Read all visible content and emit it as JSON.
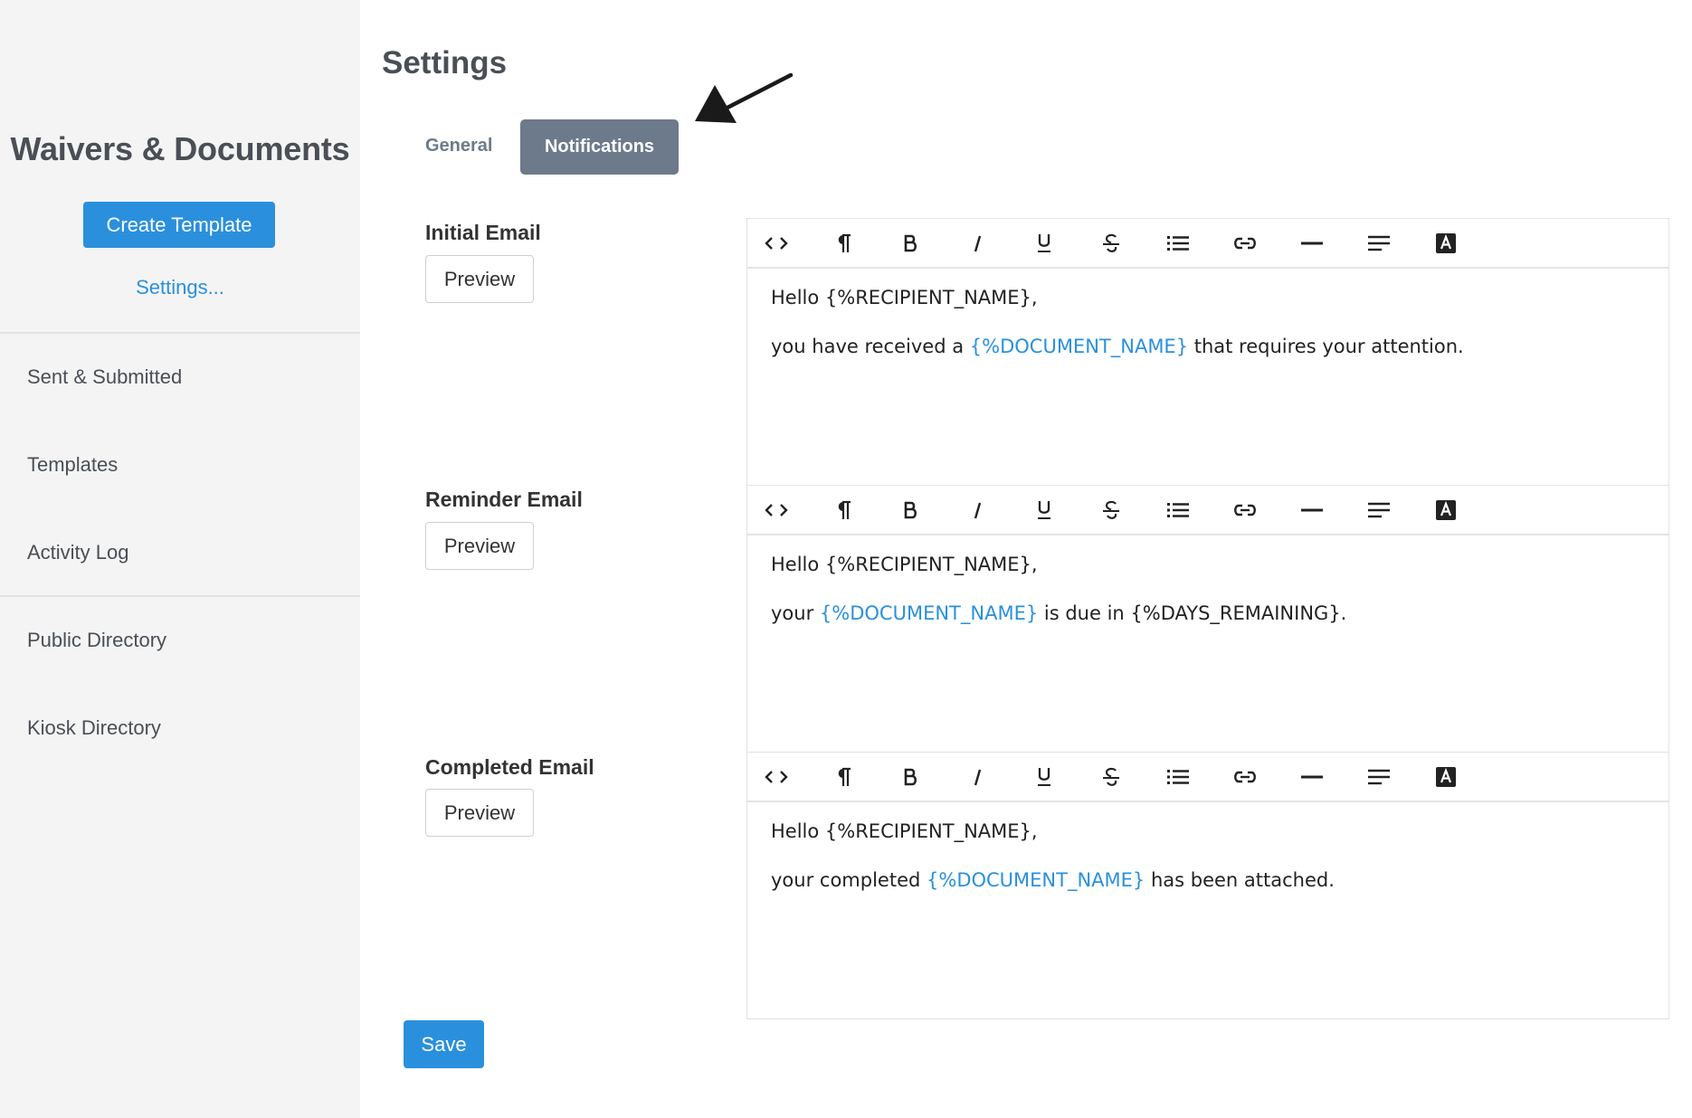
{
  "sidebar": {
    "title": "Waivers & Documents",
    "create_button": "Create Template",
    "settings_link": "Settings...",
    "items": [
      {
        "label": "Sent & Submitted"
      },
      {
        "label": "Templates"
      },
      {
        "label": "Activity Log"
      },
      {
        "label": "Public Directory"
      },
      {
        "label": "Kiosk Directory"
      }
    ]
  },
  "main": {
    "title": "Settings",
    "tabs": [
      {
        "label": "General",
        "active": false
      },
      {
        "label": "Notifications",
        "active": true
      }
    ],
    "toolbar_icons": [
      "code-view-icon",
      "paragraph-icon",
      "bold-icon",
      "italic-icon",
      "underline-icon",
      "strikethrough-icon",
      "bulleted-list-icon",
      "link-icon",
      "horizontal-rule-icon",
      "align-icon",
      "text-color-icon"
    ],
    "sections": [
      {
        "label": "Initial Email",
        "preview_label": "Preview",
        "greeting": "Hello {%RECIPIENT_NAME},",
        "line_before": "you have received a ",
        "token": "{%DOCUMENT_NAME}",
        "line_after": " that requires your attention."
      },
      {
        "label": "Reminder Email",
        "preview_label": "Preview",
        "greeting": "Hello {%RECIPIENT_NAME},",
        "line_before": "your ",
        "token": "{%DOCUMENT_NAME}",
        "line_after": " is due in {%DAYS_REMAINING}."
      },
      {
        "label": "Completed Email",
        "preview_label": "Preview",
        "greeting": "Hello {%RECIPIENT_NAME},",
        "line_before": "your completed ",
        "token": "{%DOCUMENT_NAME}",
        "line_after": " has been attached."
      }
    ],
    "save_label": "Save"
  },
  "colors": {
    "accent": "#2a90dd",
    "active_tab": "#6c7a8b",
    "sidebar_bg": "#f4f4f4"
  }
}
